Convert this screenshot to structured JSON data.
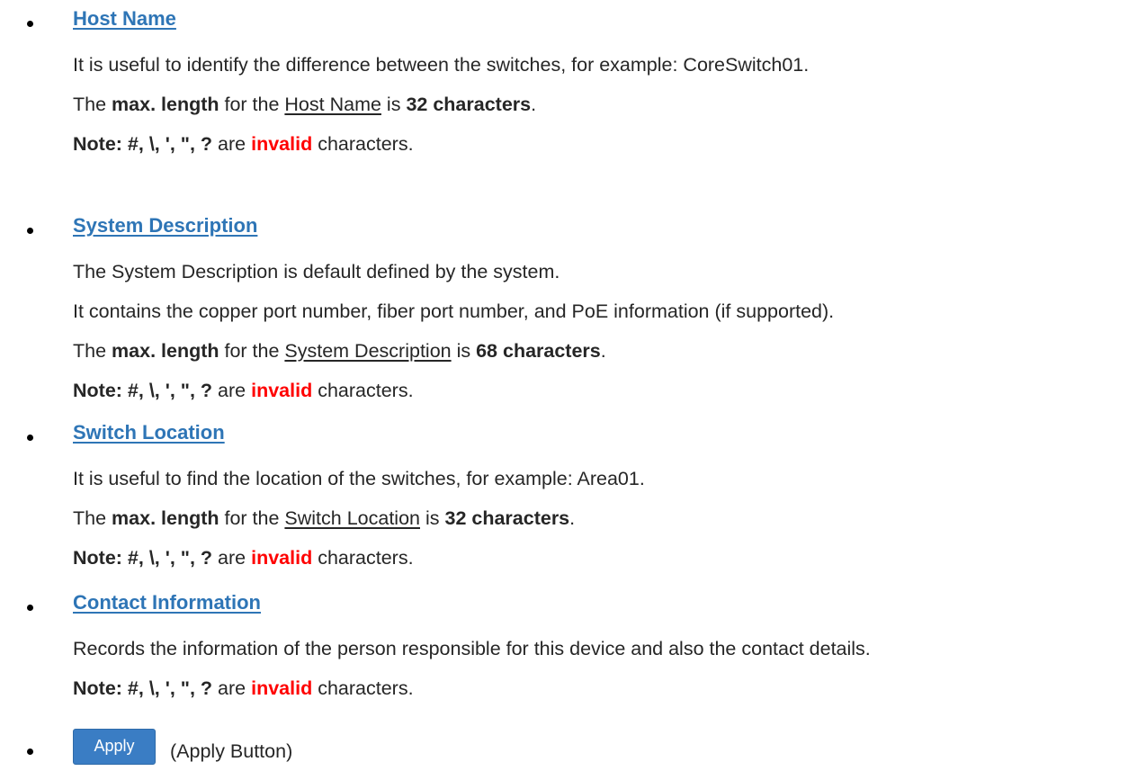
{
  "sections": [
    {
      "heading": "Host Name",
      "lines": [
        "It is useful to identify the difference between the switches, for example: CoreSwitch01."
      ],
      "maxlen": {
        "pre": "The ",
        "bold1": "max. length",
        "mid": " for the ",
        "field": "Host Name",
        "is": " is ",
        "bold2": "32 characters",
        "end": "."
      }
    },
    {
      "heading": "System Description",
      "lines": [
        "The System Description is default defined by the system.",
        "It contains the copper port number, fiber port number, and PoE information (if supported)."
      ],
      "maxlen": {
        "pre": "The ",
        "bold1": "max. length",
        "mid": " for the ",
        "field": "System Description",
        "is": " is ",
        "bold2": "68 characters",
        "end": "."
      }
    },
    {
      "heading": "Switch Location",
      "lines": [
        "It is useful to find the location of the switches, for example: Area01."
      ],
      "maxlen": {
        "pre": "The ",
        "bold1": "max. length",
        "mid": " for the ",
        "field": "Switch Location",
        "is": " is ",
        "bold2": "32 characters",
        "end": "."
      }
    },
    {
      "heading": "Contact Information",
      "lines": [
        "Records the information of the person responsible for this device and also the contact details."
      ]
    }
  ],
  "note": {
    "label": "Note: #, \\, ', \", ?",
    "are": " are ",
    "invalid": "invalid",
    "tail": " characters."
  },
  "apply": {
    "button_label": "Apply",
    "description": "(Apply Button)"
  },
  "colors": {
    "link": "#2e75b6",
    "invalid": "#ff0000",
    "button": "#3a7dc4"
  }
}
